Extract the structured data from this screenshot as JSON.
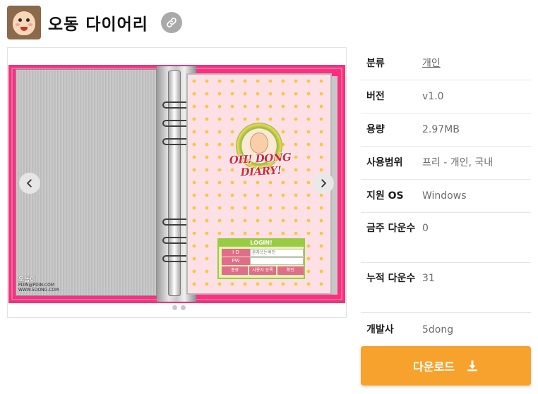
{
  "app": {
    "title": "오동 다이어리",
    "icon": "app-icon",
    "link_icon": "link-icon"
  },
  "screenshot": {
    "logo_text": "OH! DONG DIARY!",
    "login_title": "LOGIN!",
    "login_id_label": "I D",
    "login_id_value": "혼자쓰는버전",
    "login_pw_label": "PW",
    "login_buttons": [
      "종료",
      "사용자 등록",
      "확인"
    ],
    "footer_brand": "오동이",
    "footer_email": "PDIN@PDIN.COM",
    "footer_url": "WWW.5DONG.COM",
    "slides": 2,
    "current_slide": 1
  },
  "info": {
    "rows": [
      {
        "key": "분류",
        "value": "개인"
      },
      {
        "key": "버전",
        "value": "v1.0"
      },
      {
        "key": "용량",
        "value": "2.97MB"
      },
      {
        "key": "사용범위",
        "value": "프리 - 개인, 국내"
      },
      {
        "key": "지원 OS",
        "value": "Windows"
      },
      {
        "key": "금주 다운수",
        "value": "0"
      },
      {
        "key": "누적 다운수",
        "value": "31"
      },
      {
        "key": "개발사",
        "value": "5dong"
      }
    ]
  },
  "download": {
    "label": "다운로드",
    "icon": "download-icon"
  },
  "colors": {
    "accent": "#f7a22d",
    "frame_pink": "#f0337a"
  }
}
